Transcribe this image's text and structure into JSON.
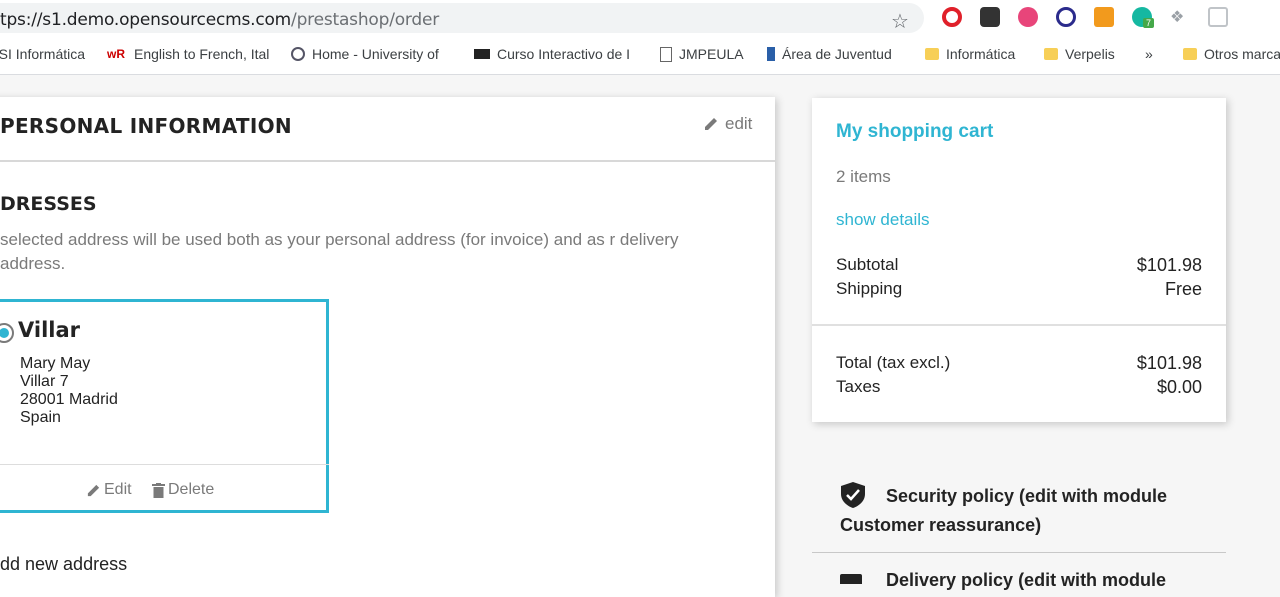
{
  "browser": {
    "url_host": "tps://s1.demo.opensourcecms.com",
    "url_path": "/prestashop/order",
    "bookmarks": [
      {
        "label": "'SI Informática"
      },
      {
        "label": "English to French, Ital"
      },
      {
        "label": "Home - University of"
      },
      {
        "label": "Curso Interactivo de I"
      },
      {
        "label": "JMPEULA"
      },
      {
        "label": "Área de Juventud"
      },
      {
        "label": "Informática"
      },
      {
        "label": "Verpelis"
      },
      {
        "label": "»"
      },
      {
        "label": "Otros marca"
      }
    ],
    "extension_badge": "7"
  },
  "checkout": {
    "section_title": "PERSONAL INFORMATION",
    "edit_label": "edit",
    "addresses_title": "DRESSES",
    "addresses_desc": " selected address will be used both as your personal address (for invoice) and as r delivery address.",
    "address": {
      "alias": "Villar",
      "lines": [
        "Mary May",
        "Villar 7",
        "28001 Madrid",
        "Spain"
      ],
      "edit": "Edit",
      "delete": "Delete"
    },
    "add_new": "dd new address"
  },
  "cart": {
    "title": "My shopping cart",
    "items": "2 items",
    "show_details": "show details",
    "subtotal_label": "Subtotal",
    "subtotal": "$101.98",
    "shipping_label": "Shipping",
    "shipping": "Free",
    "total_label": "Total (tax excl.)",
    "total": "$101.98",
    "taxes_label": "Taxes",
    "taxes": "$0.00"
  },
  "reassurance": {
    "security": "Security policy (edit with module Customer reassurance)",
    "delivery_partial": "Delivery policy (edit with module"
  },
  "colors": {
    "accent": "#2fb5d2"
  }
}
